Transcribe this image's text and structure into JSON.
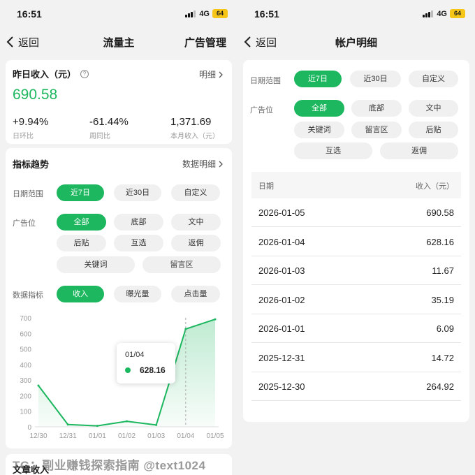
{
  "status": {
    "time": "16:51",
    "network": "4G",
    "battery": "64"
  },
  "left": {
    "nav": {
      "back": "返回",
      "title": "流量主",
      "action": "广告管理"
    },
    "income": {
      "title": "昨日收入（元）",
      "detail": "明细",
      "value": "690.58",
      "stats": [
        {
          "value": "+9.94%",
          "label": "日环比"
        },
        {
          "value": "-61.44%",
          "label": "周同比"
        },
        {
          "value": "1,371.69",
          "label": "本月收入（元）"
        }
      ]
    },
    "trend": {
      "title": "指标趋势",
      "detail": "数据明细",
      "date_label": "日期范围",
      "date_options": [
        "近7日",
        "近30日",
        "自定义"
      ],
      "pos_label": "广告位",
      "pos_options": [
        "全部",
        "底部",
        "文中",
        "后贴",
        "互选",
        "返佣",
        "关键词",
        "留言区"
      ],
      "metric_label": "数据指标",
      "metric_options": [
        "收入",
        "曝光量",
        "点击量"
      ]
    },
    "article": {
      "title": "文章收入"
    }
  },
  "right": {
    "nav": {
      "back": "返回",
      "title": "帐户明细"
    },
    "filters": {
      "date_label": "日期范围",
      "date_options": [
        "近7日",
        "近30日",
        "自定义"
      ],
      "pos_label": "广告位",
      "pos_options": [
        "全部",
        "底部",
        "文中",
        "关键词",
        "留言区",
        "后贴",
        "互选",
        "返佣"
      ]
    },
    "table": {
      "headers": [
        "日期",
        "收入（元）"
      ],
      "rows": [
        [
          "2026-01-05",
          "690.58"
        ],
        [
          "2026-01-04",
          "628.16"
        ],
        [
          "2026-01-03",
          "11.67"
        ],
        [
          "2026-01-02",
          "35.19"
        ],
        [
          "2026-01-01",
          "6.09"
        ],
        [
          "2025-12-31",
          "14.72"
        ],
        [
          "2025-12-30",
          "264.92"
        ]
      ]
    }
  },
  "chart_data": {
    "type": "area",
    "categories": [
      "12/30",
      "12/31",
      "01/01",
      "01/02",
      "01/03",
      "01/04",
      "01/05"
    ],
    "values": [
      264.92,
      14.72,
      6.09,
      35.19,
      11.67,
      628.16,
      690.58
    ],
    "yticks": [
      0,
      100,
      200,
      300,
      400,
      500,
      600,
      700
    ],
    "ylim": [
      0,
      700
    ],
    "color": "#1cb75e",
    "tooltip": {
      "x": "01/04",
      "value": "628.16"
    }
  },
  "colors": {
    "accent": "#1cb75e"
  },
  "watermark": "TG：副业赚钱探索指南 @text1024"
}
